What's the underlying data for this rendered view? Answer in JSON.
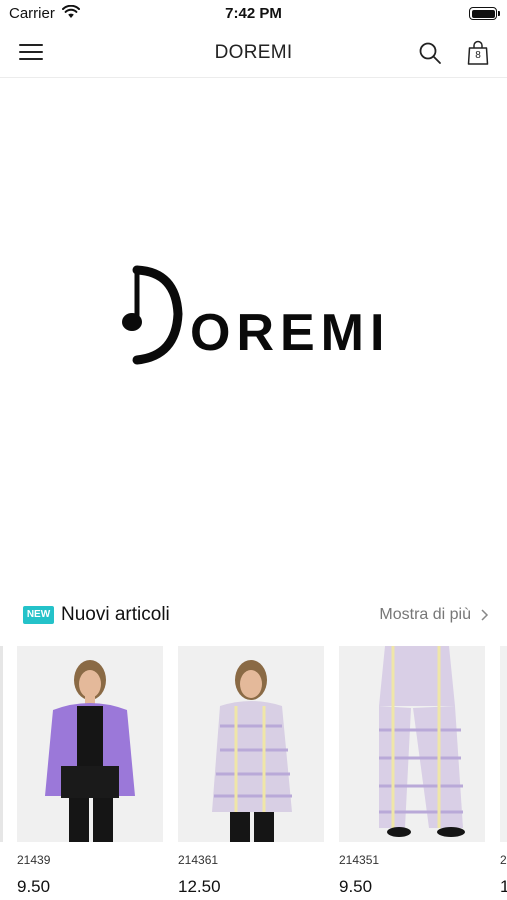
{
  "status_bar": {
    "carrier": "Carrier",
    "time": "7:42 PM"
  },
  "nav": {
    "title": "DOREMI",
    "bag_count": "8"
  },
  "banner": {
    "logo_text": "OREMI"
  },
  "section": {
    "badge": "NEW",
    "title": "Nuovi articoli",
    "show_more": "Mostra di più"
  },
  "products": [
    {
      "code": "21439",
      "price": "9.50",
      "jacket_color": "#9b78d9"
    },
    {
      "code": "214361",
      "price": "12.50",
      "jacket_color": "#d8cfe4"
    },
    {
      "code": "214351",
      "price": "9.50",
      "jacket_color": "#d9cfe6"
    }
  ],
  "partial_product": {
    "code": "2",
    "price": "1"
  },
  "colors": {
    "accent": "#24c2c9",
    "muted_text": "#777777"
  }
}
